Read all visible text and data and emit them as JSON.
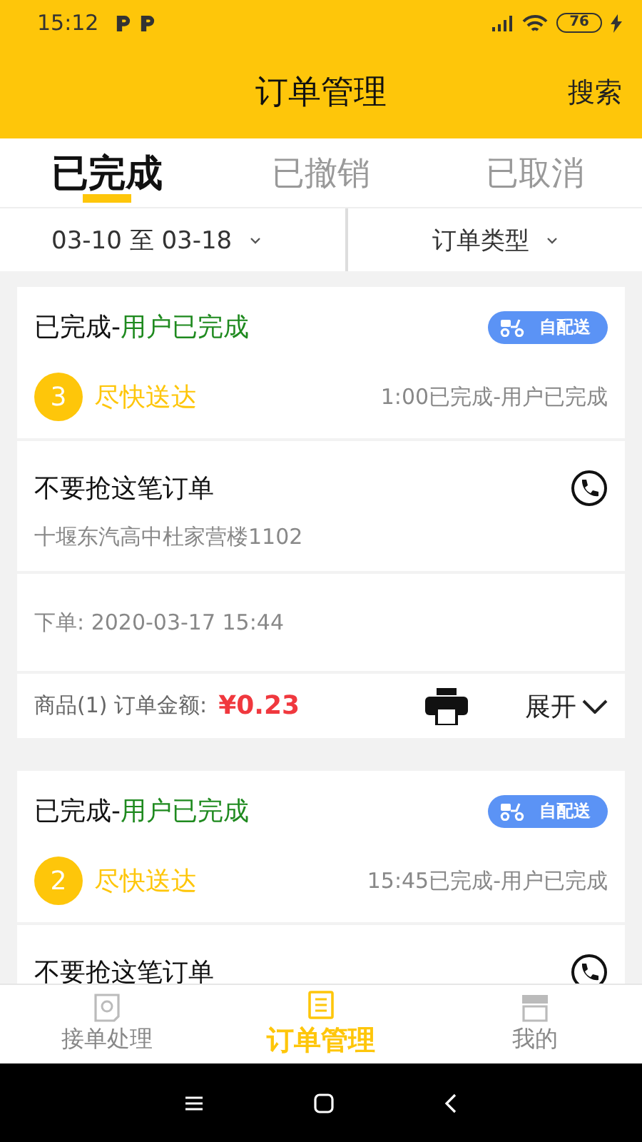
{
  "status_bar": {
    "time": "15:12",
    "battery": "76"
  },
  "header": {
    "title": "订单管理",
    "action": "搜索"
  },
  "tabs": [
    {
      "label": "已完成",
      "selected": true
    },
    {
      "label": "已撤销",
      "selected": false
    },
    {
      "label": "已取消",
      "selected": false
    }
  ],
  "filters": [
    {
      "label": "03-10 至 03-18"
    },
    {
      "label": "订单类型"
    }
  ],
  "orders": [
    {
      "status": "已完成-",
      "substatus": "用户已完成",
      "badge": "自配送",
      "number": "3",
      "priority": "尽快送达",
      "progress": "1:00已完成-用户已完成",
      "name": "不要抢这笔订单",
      "address": "十堰东汽高中杜家营楼1102",
      "placed": "下单: 2020-03-17 15:44",
      "items": "商品(1) 订单金额:",
      "amount": "¥0.23",
      "expand": "展开"
    },
    {
      "status": "已完成-",
      "substatus": "用户已完成",
      "badge": "自配送",
      "number": "2",
      "priority": "尽快送达",
      "progress": "15:45已完成-用户已完成",
      "name": "不要抢这笔订单"
    }
  ],
  "bottom_nav": [
    {
      "kind": "orders-in",
      "label": "接单处理",
      "selected": false
    },
    {
      "kind": "list",
      "label": "订单管理",
      "selected": true
    },
    {
      "kind": "shop",
      "label": "我的",
      "selected": false
    }
  ]
}
